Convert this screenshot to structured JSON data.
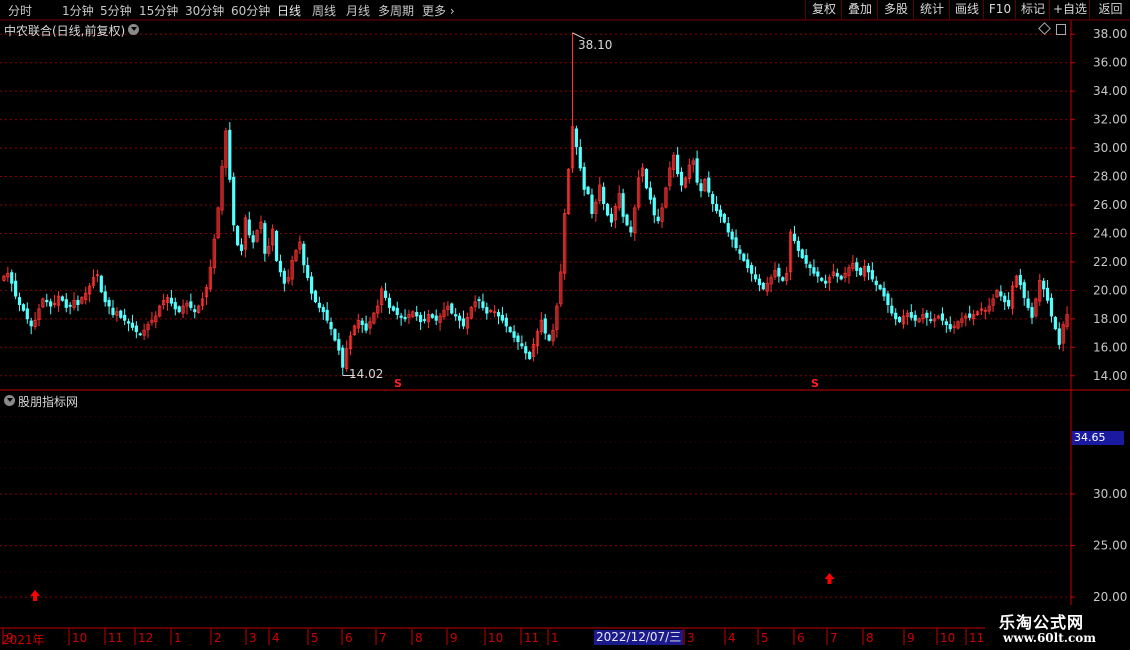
{
  "toolbar": {
    "periods": [
      "分时",
      "1分钟",
      "5分钟",
      "15分钟",
      "30分钟",
      "60分钟",
      "日线",
      "周线",
      "月线",
      "多周期",
      "更多"
    ],
    "active_period": "日线",
    "right_buttons": [
      "复权",
      "叠加",
      "多股",
      "统计",
      "画线",
      "F10",
      "标记",
      "+自选",
      "返回"
    ]
  },
  "main_title": "中农联合(日线,前复权)",
  "indicator_title": "股朋指标网",
  "annotations": {
    "high": "38.10",
    "low": "14.02"
  },
  "signal_marks": [
    "S",
    "S"
  ],
  "indicator_value": "34.65",
  "x_axis": {
    "start_label": "2021年",
    "months": [
      "9",
      "10",
      "11",
      "12",
      "1",
      "2",
      "3",
      "4",
      "5",
      "6",
      "7",
      "8",
      "9",
      "10",
      "11",
      "1",
      "3",
      "4",
      "5",
      "6",
      "7",
      "8",
      "9",
      "10",
      "11"
    ],
    "highlighted_date": "2022/12/07/三"
  },
  "watermark": {
    "line1": "乐淘公式网",
    "line2": "www.60lt.com"
  },
  "colors": {
    "up": "#ff3232",
    "down": "#54ffff",
    "grid": "#8a0000",
    "frame": "#c80000",
    "arrow": "#ff0000"
  },
  "chart_data": [
    {
      "type": "candlestick",
      "title": "中农联合(日线,前复权)",
      "ylim": [
        13.0,
        39.0
      ],
      "yticks": [
        14.0,
        16.0,
        18.0,
        20.0,
        22.0,
        24.0,
        26.0,
        28.0,
        30.0,
        32.0,
        34.0,
        36.0,
        38.0
      ],
      "ytick_labels": [
        "14.00",
        "16.00",
        "18.00",
        "20.00",
        "22.00",
        "24.00",
        "26.00",
        "28.00",
        "30.00",
        "32.00",
        "34.00",
        "36.00",
        "38.00"
      ],
      "grid": true,
      "close_series": [
        21.0,
        21.2,
        20.5,
        19.6,
        19.0,
        18.6,
        18.0,
        17.5,
        17.9,
        18.7,
        19.4,
        19.2,
        18.9,
        19.1,
        19.6,
        19.3,
        18.8,
        18.9,
        19.3,
        19.0,
        19.5,
        19.8,
        20.3,
        20.9,
        21.1,
        19.9,
        19.2,
        18.9,
        18.3,
        18.5,
        18.1,
        17.9,
        17.7,
        17.4,
        17.1,
        16.9,
        17.2,
        17.6,
        17.9,
        18.2,
        18.9,
        19.3,
        19.5,
        19.1,
        18.7,
        18.5,
        18.9,
        19.1,
        18.8,
        18.5,
        18.9,
        19.4,
        20.2,
        21.6,
        23.6,
        25.8,
        28.7,
        31.2,
        27.8,
        24.6,
        23.2,
        22.8,
        25.1,
        23.9,
        23.4,
        24.2,
        24.8,
        22.6,
        23.1,
        24.3,
        22.1,
        21.3,
        20.5,
        20.9,
        22.1,
        22.8,
        23.4,
        21.8,
        20.9,
        19.8,
        19.2,
        18.8,
        18.5,
        17.9,
        17.3,
        16.5,
        15.8,
        14.6,
        15.9,
        16.8,
        17.5,
        17.9,
        17.6,
        17.2,
        17.8,
        18.4,
        18.9,
        20.1,
        19.5,
        18.8,
        18.6,
        18.3,
        18.1,
        18.0,
        18.3,
        18.5,
        18.2,
        17.8,
        17.9,
        18.3,
        18.1,
        17.9,
        18.2,
        18.6,
        18.9,
        18.4,
        18.2,
        17.9,
        17.5,
        18.1,
        18.8,
        19.2,
        19.3,
        18.8,
        18.4,
        18.6,
        18.5,
        18.2,
        17.9,
        17.5,
        17.1,
        16.7,
        16.4,
        16.1,
        15.6,
        15.2,
        16.2,
        17.1,
        17.9,
        17.0,
        16.5,
        17.2,
        18.9,
        21.3,
        25.4,
        28.5,
        31.5,
        30.1,
        28.6,
        27.1,
        26.8,
        25.4,
        26.2,
        27.4,
        26.1,
        25.3,
        24.8,
        25.9,
        26.8,
        25.2,
        24.6,
        24.1,
        25.8,
        27.9,
        28.6,
        27.2,
        26.4,
        25.3,
        24.9,
        25.8,
        27.2,
        28.6,
        29.5,
        28.2,
        27.4,
        27.9,
        28.8,
        29.1,
        27.6,
        27.0,
        27.8,
        26.9,
        26.1,
        25.6,
        25.2,
        24.8,
        24.1,
        23.6,
        23.0,
        22.6,
        22.1,
        21.6,
        21.2,
        20.8,
        20.4,
        20.1,
        20.5,
        20.9,
        21.4,
        21.0,
        20.7,
        21.2,
        24.1,
        23.5,
        22.8,
        22.3,
        21.9,
        21.6,
        21.2,
        21.0,
        20.7,
        20.5,
        20.9,
        21.3,
        21.0,
        20.8,
        21.2,
        21.6,
        21.9,
        21.4,
        21.1,
        21.7,
        21.3,
        20.8,
        20.4,
        20.1,
        19.6,
        19.0,
        18.4,
        18.0,
        17.8,
        18.2,
        18.4,
        18.1,
        17.9,
        18.0,
        18.3,
        18.1,
        17.9,
        18.0,
        18.2,
        17.9,
        17.6,
        17.3,
        17.5,
        17.8,
        18.0,
        18.2,
        18.1,
        18.3,
        18.5,
        18.7,
        18.6,
        18.9,
        19.4,
        20.0,
        19.6,
        19.2,
        18.9,
        20.3,
        21.0,
        20.4,
        19.5,
        18.8,
        18.1,
        19.4,
        20.7,
        20.1,
        19.3,
        18.2,
        17.3,
        16.2,
        17.6,
        18.3
      ],
      "annotations": [
        {
          "text": "38.10",
          "value": 38.1
        },
        {
          "text": "14.02",
          "value": 14.02
        }
      ]
    },
    {
      "type": "line",
      "title": "股朋指标网",
      "ylim": [
        17.0,
        40.0
      ],
      "yticks": [
        20.0,
        25.0,
        30.0
      ],
      "ytick_labels": [
        "20.00",
        "25.00",
        "30.00"
      ],
      "last_value": 34.65,
      "grid": true,
      "markers": [
        {
          "type": "up-arrow",
          "index": 8
        },
        {
          "type": "up-arrow",
          "index": 212
        }
      ]
    }
  ]
}
